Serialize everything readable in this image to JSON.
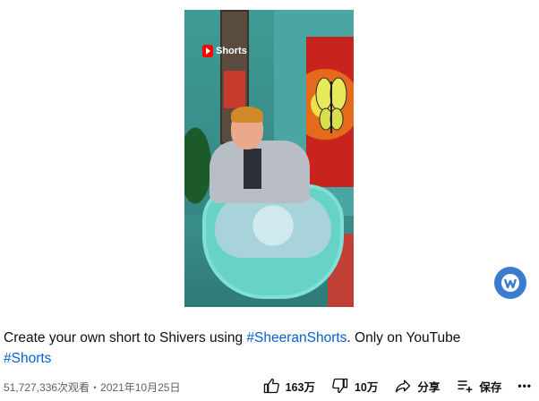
{
  "video": {
    "badge_label": "Shorts"
  },
  "description": {
    "prefix": "Create your own short to Shivers using ",
    "hashtag1": "#SheeranShorts",
    "suffix": ". Only on YouTube",
    "hashtag2": "#Shorts"
  },
  "meta": {
    "views_date": "51,727,336次观看・2021年10月25日",
    "like_count": "163万",
    "dislike_count": "10万",
    "share_label": "分享",
    "save_label": "保存",
    "more_label": "•••"
  },
  "colors": {
    "hashtag": "#065fd4",
    "badge_red": "#ff0000",
    "channel_logo": "#3b7bd0"
  },
  "icons": [
    "shorts-logo-icon",
    "thumbs-up-icon",
    "thumbs-down-icon",
    "share-icon",
    "save-playlist-icon",
    "more-icon"
  ]
}
